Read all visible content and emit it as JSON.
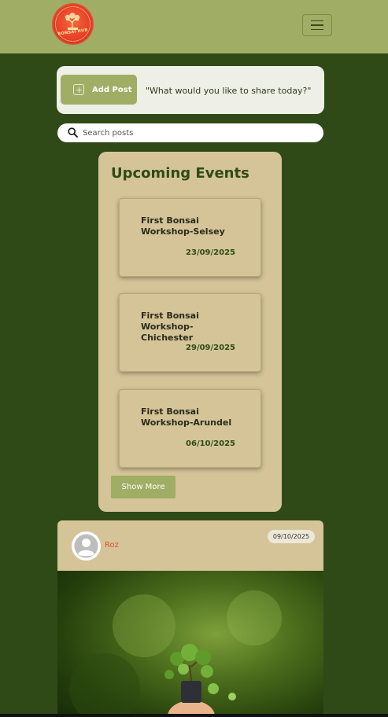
{
  "header": {
    "logo_text": "BONSAI HUB",
    "menu_icon": "hamburger-menu-icon",
    "colors": {
      "header_bg": "#a0ad64",
      "page_bg": "#2f4a17"
    }
  },
  "add_post": {
    "button_label": "Add Post",
    "icon": "plus-square-icon",
    "prompt": "\"What would you like to share today?\""
  },
  "search": {
    "placeholder": "Search posts",
    "value": "",
    "icon": "search-icon"
  },
  "events": {
    "title": "Upcoming Events",
    "items": [
      {
        "name": "First Bonsai Workshop-Selsey",
        "date": "23/09/2025"
      },
      {
        "name": "First Bonsai Workshop-Chichester",
        "date": "29/09/2025"
      },
      {
        "name": "First Bonsai Workshop-Arundel",
        "date": "06/10/2025"
      }
    ],
    "show_more_label": "Show More"
  },
  "post": {
    "author": "Roz",
    "date": "09/10/2025",
    "avatar_icon": "user-avatar-icon",
    "image": "bonsai-tree-photo"
  }
}
